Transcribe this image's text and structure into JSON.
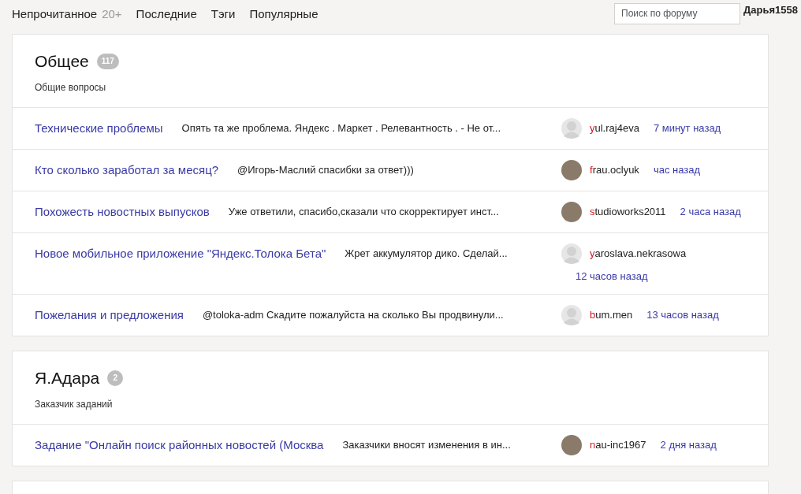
{
  "nav": [
    {
      "label": "Непрочитанное",
      "count": "20+"
    },
    {
      "label": "Последние"
    },
    {
      "label": "Тэги"
    },
    {
      "label": "Популярные"
    }
  ],
  "search": {
    "placeholder": "Поиск по форуму"
  },
  "user": "Дарья1558",
  "categories": [
    {
      "title": "Общее",
      "count": "117",
      "description": "Общие вопросы",
      "topics": [
        {
          "title": "Технические проблемы",
          "excerpt": "Опять та же проблема. Яндекс . Маркет . Релевантность . - Не от...",
          "author": "yul.raj4eva",
          "avatar": {
            "kind": "default"
          },
          "time": "7 минут назад"
        },
        {
          "title": "Кто сколько заработал за месяц?",
          "excerpt": "@Игорь-Маслий спасибки за ответ)))",
          "author": "frau.oclyuk",
          "avatar": {
            "kind": "photo"
          },
          "time": "час назад"
        },
        {
          "title": "Похожесть новостных выпусков",
          "excerpt": "Уже ответили, спасибо,сказали что скорректирует инст...",
          "author": "studioworks2011",
          "avatar": {
            "kind": "photo"
          },
          "time": "2 часа назад"
        },
        {
          "title": "Новое мобильное приложение \"Яндекс.Толока Бета\"",
          "excerpt": "Жрет аккумулятор дико. Сделай...",
          "author": "yaroslava.nekrasowa",
          "avatar": {
            "kind": "default"
          },
          "time": "12 часов назад"
        },
        {
          "title": "Пожелания и предложения",
          "excerpt": "@toloka-adm Скадите пожалуйста на сколько Вы продвинули...",
          "author": "bum.men",
          "avatar": {
            "kind": "default"
          },
          "time": "13 часов назад"
        }
      ]
    },
    {
      "title": "Я.Адара",
      "count": "2",
      "description": "Заказчик заданий",
      "topics": [
        {
          "title": "Задание \"Онлайн поиск районных новостей (Москва",
          "excerpt": "Заказчики вносят изменения в ин...",
          "author": "nau-inc1967",
          "avatar": {
            "kind": "photo"
          },
          "time": "2 дня назад"
        }
      ]
    }
  ]
}
